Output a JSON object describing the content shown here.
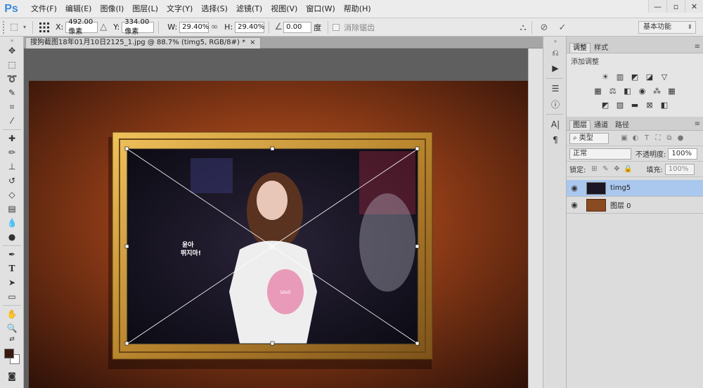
{
  "menu": {
    "logo": "Ps",
    "items": [
      "文件(F)",
      "编辑(E)",
      "图像(I)",
      "图层(L)",
      "文字(Y)",
      "选择(S)",
      "滤镜(T)",
      "视图(V)",
      "窗口(W)",
      "帮助(H)"
    ]
  },
  "window_controls": {
    "minimize": "—",
    "restore": "▫",
    "close": "✕"
  },
  "options": {
    "x_label": "X:",
    "x_value": "492.00 像素",
    "y_label": "Y:",
    "y_value": "334.00 像素",
    "w_label": "W:",
    "w_value": "29.40%",
    "h_label": "H:",
    "h_value": "29.40%",
    "angle_value": "0.00",
    "angle_unit": "度",
    "antialias_label": "消除锯齿",
    "workspace": "基本功能"
  },
  "document": {
    "tab_title": "搜狗截图18年01月10日2125_1.jpg @ 88.7% (timg5, RGB/8#) *",
    "tab_close": "×",
    "photo_caption_line1": "윤아",
    "photo_caption_line2": "뛰지마!",
    "shirt_text": "SAVE"
  },
  "panels": {
    "adjust_tabs": [
      "调整",
      "样式"
    ],
    "adjust_title": "添加调整",
    "layers_tabs": [
      "图层",
      "通道",
      "路径"
    ],
    "filter_kind": "类型",
    "blend_mode": "正常",
    "opacity_label": "不透明度:",
    "opacity_value": "100%",
    "lock_label": "锁定:",
    "fill_label": "填充:",
    "fill_value": "100%",
    "layers": [
      {
        "name": "timg5",
        "selected": true
      },
      {
        "name": "图层 0",
        "selected": false
      }
    ]
  },
  "colors": {
    "foreground": "#3a1a10",
    "background": "#ffffff",
    "selection": "#aac8ee"
  }
}
